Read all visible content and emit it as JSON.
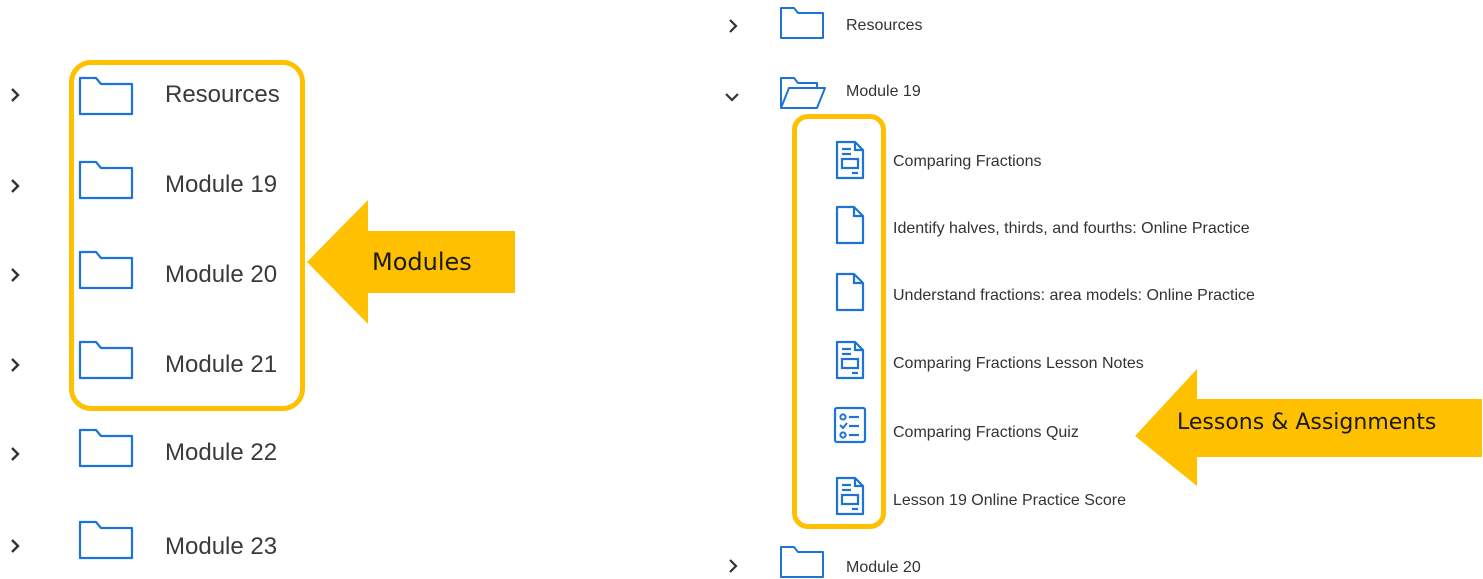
{
  "left_panel": {
    "items": [
      {
        "label": "Resources",
        "icon": "folder-icon"
      },
      {
        "label": "Module 19",
        "icon": "folder-icon"
      },
      {
        "label": "Module 20",
        "icon": "folder-icon"
      },
      {
        "label": "Module 21",
        "icon": "folder-icon"
      },
      {
        "label": "Module 22",
        "icon": "folder-icon"
      },
      {
        "label": "Module 23",
        "icon": "folder-icon"
      }
    ],
    "callout": "Modules"
  },
  "right_panel": {
    "folders": [
      {
        "label": "Resources",
        "expanded": false
      },
      {
        "label": "Module 19",
        "expanded": true
      },
      {
        "label": "Module 20",
        "expanded": false
      }
    ],
    "module19_items": [
      {
        "label": "Comparing Fractions",
        "icon": "page-icon"
      },
      {
        "label": "Identify halves, thirds, and fourths: Online Practice",
        "icon": "file-icon"
      },
      {
        "label": "Understand fractions: area models: Online Practice",
        "icon": "file-icon"
      },
      {
        "label": "Comparing Fractions Lesson Notes",
        "icon": "page-icon"
      },
      {
        "label": "Comparing Fractions Quiz",
        "icon": "quiz-icon"
      },
      {
        "label": "Lesson 19 Online Practice Score",
        "icon": "page-icon"
      }
    ],
    "callout": "Lessons & Assignments"
  },
  "colors": {
    "icon_blue": "#1e74d6",
    "highlight": "#ffc000",
    "chevron": "#333333"
  }
}
